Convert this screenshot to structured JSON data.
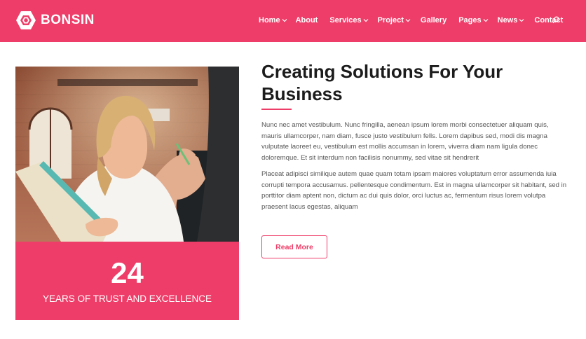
{
  "brand": {
    "name": "BONSIN",
    "accent_color": "#ee3d68"
  },
  "nav": {
    "items": [
      {
        "label": "Home",
        "dropdown": true
      },
      {
        "label": "About",
        "dropdown": false
      },
      {
        "label": "Services",
        "dropdown": true
      },
      {
        "label": "Project",
        "dropdown": true
      },
      {
        "label": "Gallery",
        "dropdown": false
      },
      {
        "label": "Pages",
        "dropdown": true
      },
      {
        "label": "News",
        "dropdown": true
      },
      {
        "label": "Contact",
        "dropdown": false
      }
    ],
    "search_icon": "search-icon"
  },
  "feature": {
    "image": "woman-with-tablet-in-office-photo",
    "stat_number": "24",
    "stat_label": "YEARS OF TRUST AND EXCELLENCE"
  },
  "content": {
    "title": "Creating Solutions For Your Business",
    "paragraph_1": "Nunc nec amet vestibulum. Nunc fringilla, aenean ipsum lorem morbi consectetuer aliquam quis, mauris ullamcorper, nam diam, fusce justo vestibulum fells. Lorem dapibus sed, modi dis magna vulputate laoreet eu, vestibulum est mollis accumsan in lorem, viverra diam nam ligula donec doloremque. Et sit interdum non facilisis nonummy, sed vitae sit hendrerit",
    "paragraph_2": "Placeat adipisci similique autem quae quam totam ipsam maiores voluptatum error assumenda iuia corrupti tempora accusamus. pellentesque condimentum. Est in magna ullamcorper sit habitant, sed in porttitor diam aptent non, dictum ac dui quis dolor, orci luctus ac, fermentum risus lorem volutpa praesent lacus egestas, aliquam",
    "button_label": "Read More"
  }
}
